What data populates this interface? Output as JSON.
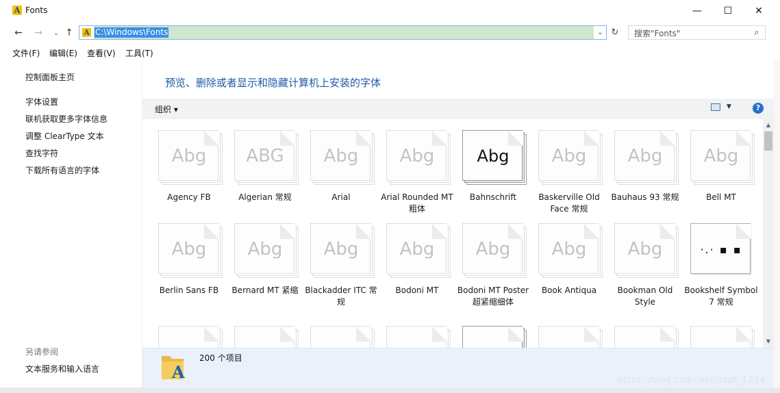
{
  "window": {
    "title": "Fonts"
  },
  "title_buttons": {
    "minimize": "—",
    "maximize": "☐",
    "close": "✕"
  },
  "nav": {
    "back": "←",
    "forward": "→",
    "recent": "⌄",
    "up": "↑",
    "dropdown": "⌄",
    "refresh": "↻"
  },
  "address": {
    "path": "C:\\Windows\\Fonts",
    "icon": "A"
  },
  "search": {
    "placeholder": "搜索\"Fonts\"",
    "icon": "⌕"
  },
  "menu": [
    "文件(F)",
    "编辑(E)",
    "查看(V)",
    "工具(T)"
  ],
  "sidebar": {
    "home": "控制面板主页",
    "links": [
      "字体设置",
      "联机获取更多字体信息",
      "调整 ClearType 文本",
      "查找字符",
      "下载所有语言的字体"
    ],
    "see_also_label": "另请参阅",
    "see_also_links": [
      "文本服务和输入语言"
    ]
  },
  "main": {
    "heading": "预览、删除或者显示和隐藏计算机上安装的字体",
    "organize": "组织 ▾",
    "view_dropdown": "▼",
    "help": "?"
  },
  "fonts": [
    {
      "name": "Agency FB",
      "sample": "Abg"
    },
    {
      "name": "Algerian 常规",
      "sample": "ABG"
    },
    {
      "name": "Arial",
      "sample": "Abg"
    },
    {
      "name": "Arial Rounded MT 粗体",
      "sample": "Abg"
    },
    {
      "name": "Bahnschrift",
      "sample": "Abg",
      "selected": true
    },
    {
      "name": "Baskerville Old Face 常规",
      "sample": "Abg"
    },
    {
      "name": "Bauhaus 93 常规",
      "sample": "Abg"
    },
    {
      "name": "Bell MT",
      "sample": "Abg"
    },
    {
      "name": "Berlin Sans FB",
      "sample": "Abg"
    },
    {
      "name": "Bernard MT 紧缩",
      "sample": "Abg"
    },
    {
      "name": "Blackadder ITC 常规",
      "sample": "Abg"
    },
    {
      "name": "Bodoni MT",
      "sample": "Abg"
    },
    {
      "name": "Bodoni MT Poster 超紧缩细体",
      "sample": "Abg"
    },
    {
      "name": "Book Antiqua",
      "sample": "Abg"
    },
    {
      "name": "Bookman Old Style",
      "sample": "Abg"
    },
    {
      "name": "Bookshelf Symbol 7 常规",
      "sample": "·.·  ▪  ▪",
      "symbol": true
    }
  ],
  "details": {
    "count": "200 个项目"
  },
  "watermark": "https://blog.csdn.net/asdf_1234",
  "colors": {
    "accent": "#1e5aa8",
    "selection": "#3a8ee6",
    "address_fill": "#cde8cd",
    "details_bg": "#eaf1fb"
  }
}
